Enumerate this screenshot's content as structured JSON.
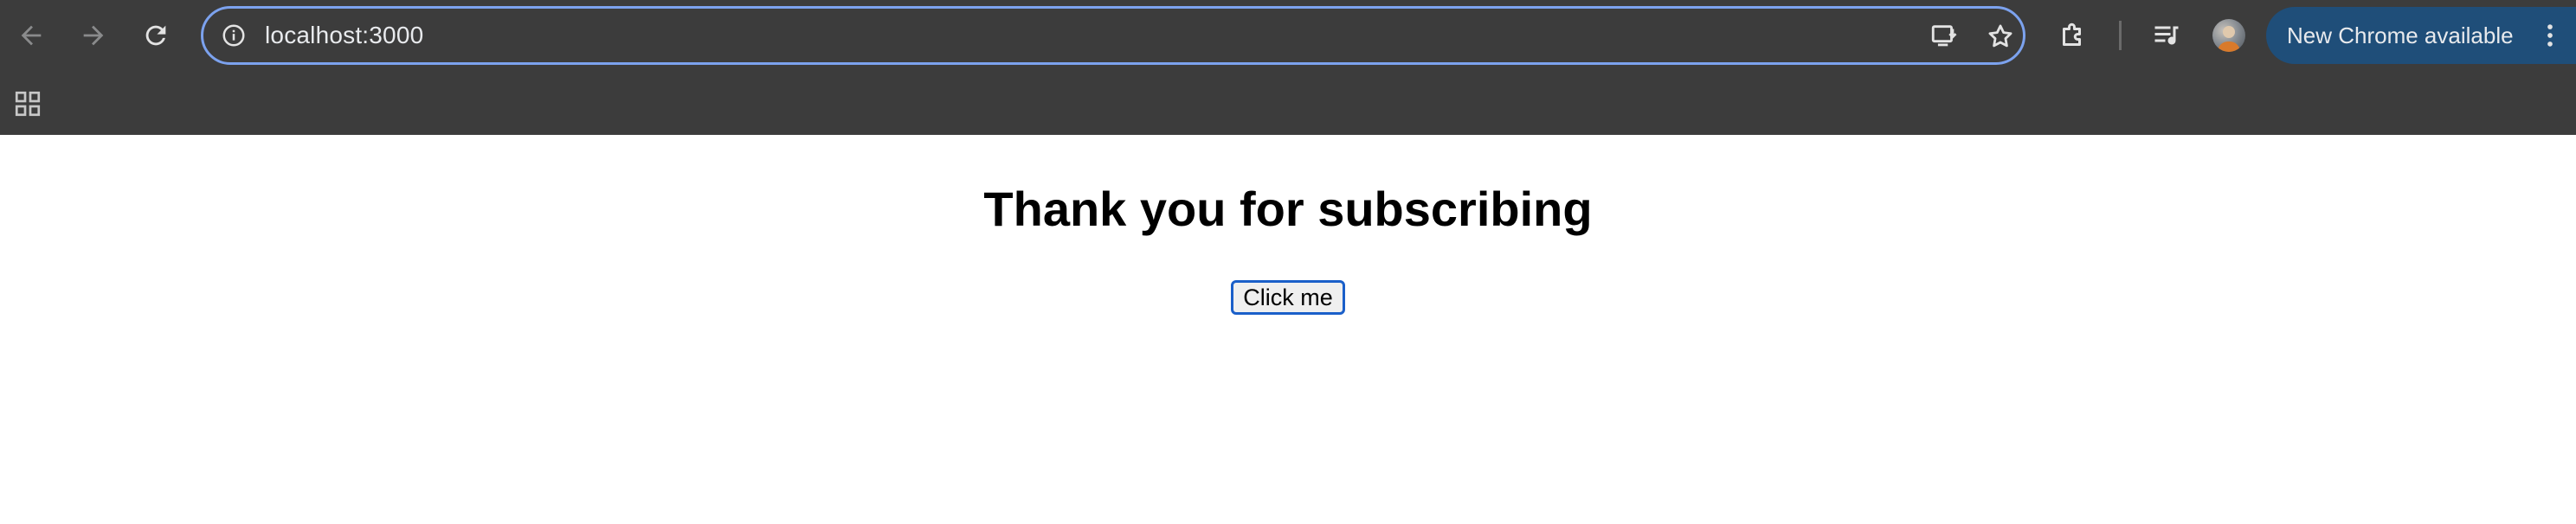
{
  "browser": {
    "url": "localhost:3000",
    "update_label": "New Chrome available",
    "accent_color": "#7ca2ee",
    "update_pill_color": "#1f4e79",
    "icons": {
      "back": "arrow-left-icon",
      "forward": "arrow-right-icon",
      "reload": "reload-icon",
      "site_info": "info-icon",
      "install": "install-app-icon",
      "bookmark": "star-icon",
      "extensions": "puzzle-icon",
      "media": "media-controls-icon",
      "menu": "kebab-menu-icon",
      "apps": "apps-grid-icon"
    }
  },
  "page": {
    "title": "Thank you for subscribing",
    "button_label": "Click me"
  }
}
